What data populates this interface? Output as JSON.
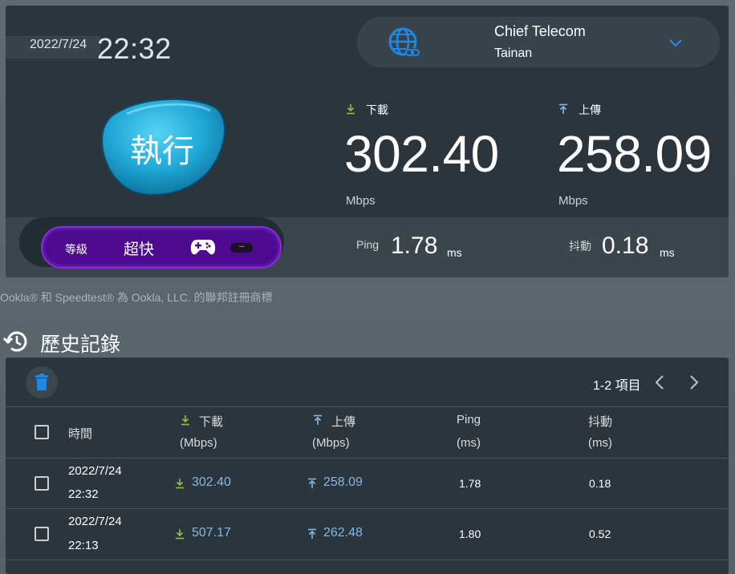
{
  "header": {
    "date": "2022/7/24",
    "time": "22:32"
  },
  "server": {
    "name": "Chief Telecom",
    "city": "Tainan",
    "icon": "globe-link-icon"
  },
  "run_button": {
    "label": "執行"
  },
  "rank": {
    "label": "等級",
    "value": "超快",
    "more": "···"
  },
  "download": {
    "label": "下載",
    "value": "302.40",
    "unit": "Mbps"
  },
  "upload": {
    "label": "上傳",
    "value": "258.09",
    "unit": "Mbps"
  },
  "ping": {
    "label": "Ping",
    "value": "1.78",
    "unit": "ms"
  },
  "jitter": {
    "label": "抖動",
    "value": "0.18",
    "unit": "ms"
  },
  "trademark": "Ookla® 和 Speedtest® 為 Ookla, LLC. 的聯邦註冊商標",
  "history": {
    "title": "歷史記錄",
    "pager": "1-2 項目",
    "columns": {
      "time": "時間",
      "download": "下載",
      "download_unit": "(Mbps)",
      "upload": "上傳",
      "upload_unit": "(Mbps)",
      "ping": "Ping",
      "ping_unit": "(ms)",
      "jitter": "抖動",
      "jitter_unit": "(ms)"
    },
    "rows": [
      {
        "date": "2022/7/24",
        "time": "22:32",
        "download": "302.40",
        "upload": "258.09",
        "ping": "1.78",
        "jitter": "0.18"
      },
      {
        "date": "2022/7/24",
        "time": "22:13",
        "download": "507.17",
        "upload": "262.48",
        "ping": "1.80",
        "jitter": "0.52"
      }
    ]
  },
  "colors": {
    "accent_blue": "#1e88e5",
    "download_green": "#8bc34a",
    "upload_blue": "#82b9e6",
    "rank_purple": "#4d0a8f"
  }
}
